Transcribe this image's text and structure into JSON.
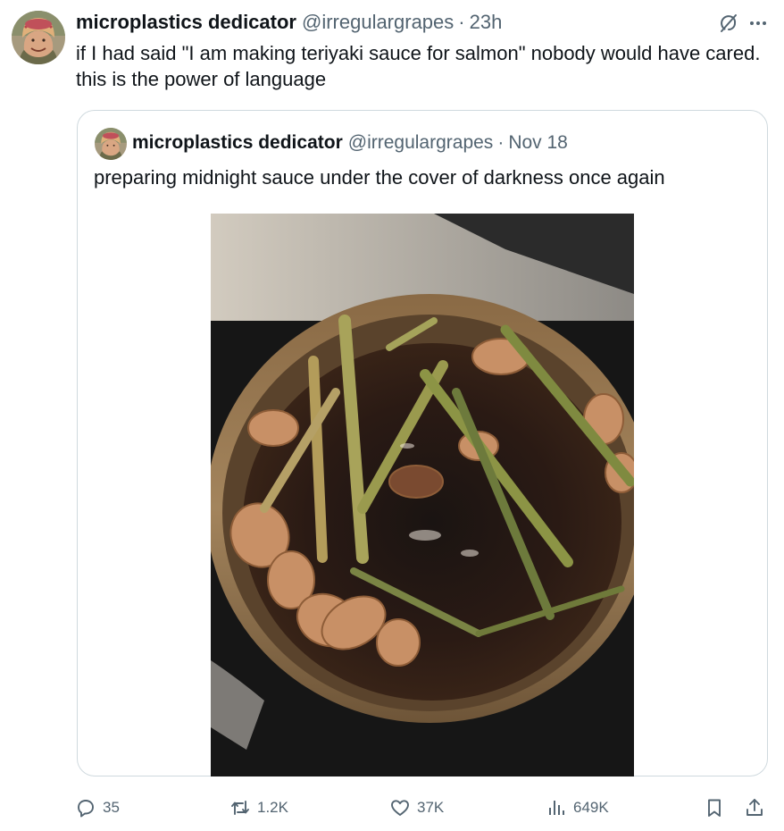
{
  "tweet": {
    "author_name": "microplastics dedicator",
    "author_handle": "@irregulargrapes",
    "separator": "·",
    "time": "23h",
    "text": "if I had said \"I am making teriyaki sauce for salmon\" nobody would have cared. this is the power of language"
  },
  "quote": {
    "author_name": "microplastics dedicator",
    "author_handle": "@irregulargrapes",
    "separator": "·",
    "date": "Nov 18",
    "text": "preparing midnight sauce under the cover of darkness once again"
  },
  "actions": {
    "replies": "35",
    "reposts": "1.2K",
    "likes": "37K",
    "views": "649K"
  },
  "icons": {
    "top_right": [
      "grok-icon",
      "more-icon"
    ],
    "actions": [
      "reply-icon",
      "repost-icon",
      "like-icon",
      "views-icon",
      "bookmark-icon",
      "share-icon"
    ]
  },
  "colors": {
    "text_primary": "#0f1419",
    "text_secondary": "#536471",
    "border": "#cfd9de"
  }
}
